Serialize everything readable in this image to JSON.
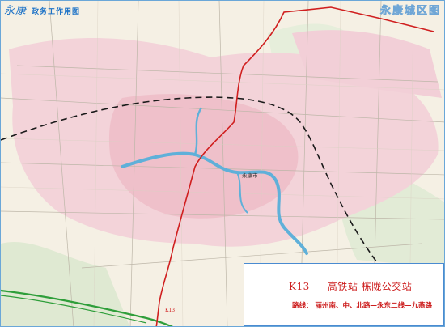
{
  "map": {
    "brand": "永康",
    "subtitle": "政务工作用图",
    "region_title": "永康城区图",
    "center_label": "永康市",
    "route_marker": "K13"
  },
  "route": {
    "code": "K13",
    "endpoints": "高铁站-栋陇公交站",
    "path_label": "路线：",
    "path": "丽州南、中、北路—永东二线—九燕路"
  },
  "colors": {
    "route_line": "#d01f1f",
    "railway": "#1a1a1a",
    "expressway": "#2e9e3a",
    "urban": "#f1c9d1",
    "water": "#5fb0d9",
    "accent": "#1e73c7"
  }
}
